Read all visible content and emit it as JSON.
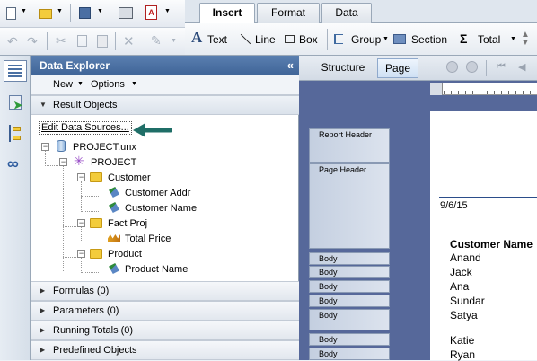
{
  "ribbon": {
    "tabs": [
      "Insert",
      "Format",
      "Data"
    ],
    "insert": {
      "text_label": "Text",
      "line_label": "Line",
      "box_label": "Box",
      "group_label": "Group",
      "section_label": "Section",
      "total_label": "Total"
    }
  },
  "explorer": {
    "title": "Data Explorer",
    "collapse_glyph": "«",
    "new_label": "New",
    "options_label": "Options",
    "result_objects_label": "Result Objects",
    "edit_data_sources_label": "Edit Data Sources...",
    "tree": {
      "universe": "PROJECT.unx",
      "project": "PROJECT",
      "customer_folder": "Customer",
      "customer_addr": "Customer Addr",
      "customer_name": "Customer Name",
      "fact_folder": "Fact Proj",
      "total_price": "Total Price",
      "product_folder": "Product",
      "product_name": "Product Name"
    },
    "sections": [
      "Formulas (0)",
      "Parameters (0)",
      "Running Totals (0)",
      "Predefined Objects"
    ]
  },
  "design": {
    "tabs": [
      "Structure",
      "Page"
    ],
    "section_labels": [
      "Report Header",
      "Page Header",
      "Body",
      "Body",
      "Body",
      "Body",
      "Body",
      "Body",
      "Body"
    ],
    "page": {
      "date": "9/6/15",
      "column_header": "Customer Name",
      "names": [
        "Anand",
        "Jack",
        "Ana",
        "Sundar",
        "Satya",
        "Katie",
        "Ryan"
      ]
    }
  },
  "colors": {
    "panel_header": "#4a70a3",
    "design_background": "#56689a",
    "arrow": "#1f6e67"
  }
}
